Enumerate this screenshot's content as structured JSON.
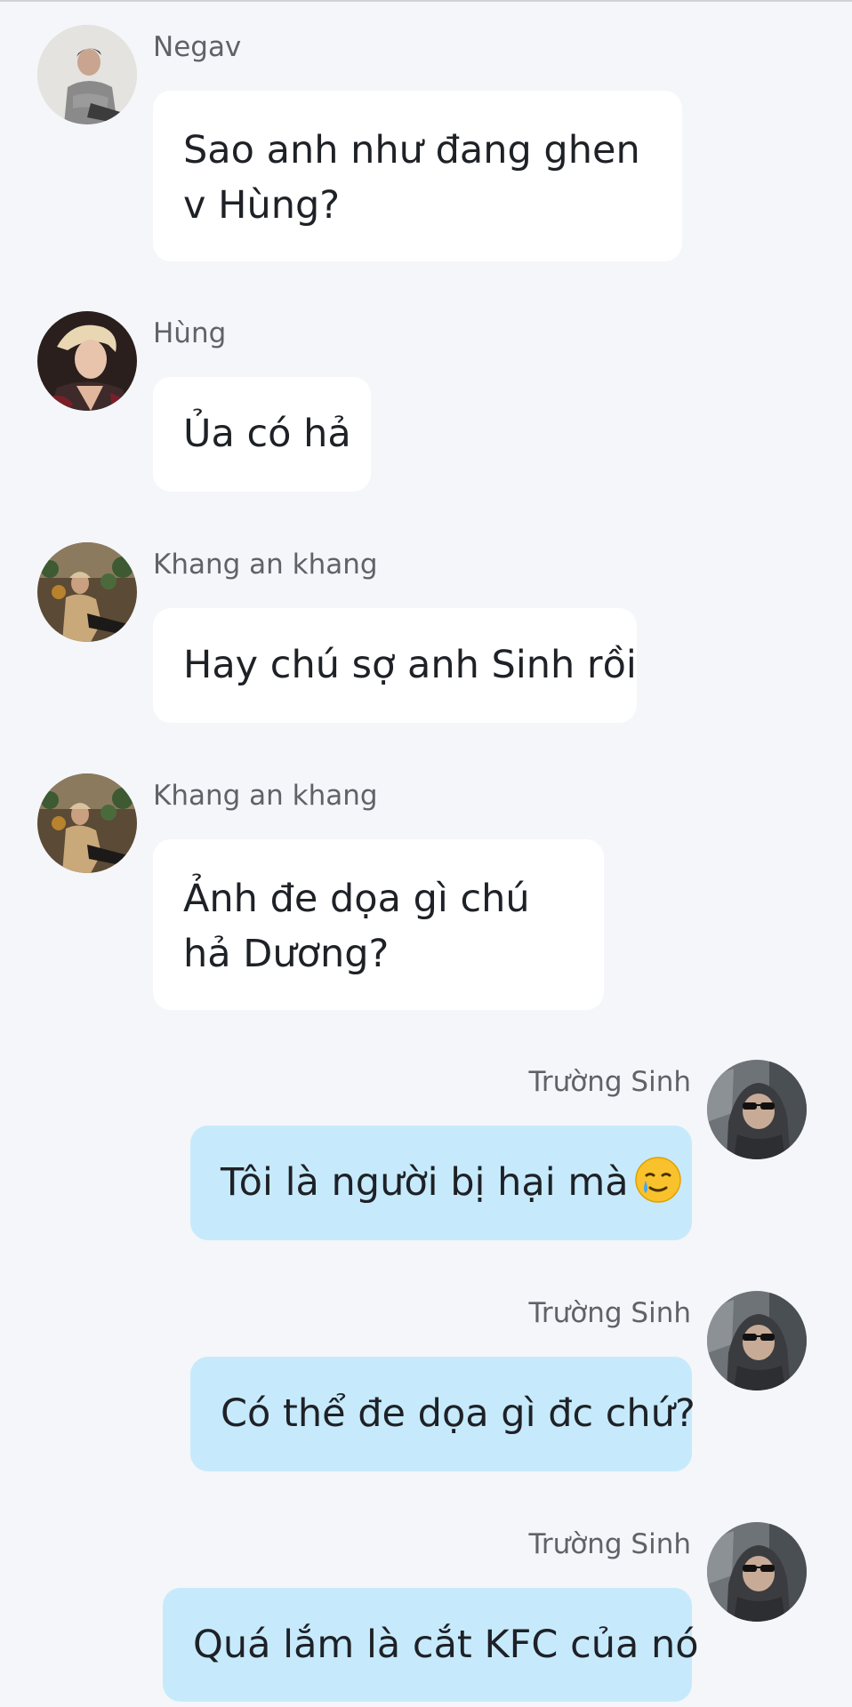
{
  "messages": [
    {
      "sender": "Negav",
      "text_lines": [
        "Sao anh như đang ghen",
        "v Hùng?"
      ],
      "direction": "incoming",
      "avatar_icon": "avatar-negav"
    },
    {
      "sender": "Hùng",
      "text_lines": [
        "Ủa có hả"
      ],
      "direction": "incoming",
      "avatar_icon": "avatar-hung"
    },
    {
      "sender": "Khang an khang",
      "text_lines": [
        "Hay chú sợ anh Sinh rồi"
      ],
      "direction": "incoming",
      "avatar_icon": "avatar-khang"
    },
    {
      "sender": "Khang an khang",
      "text_lines": [
        "Ảnh đe dọa gì chú",
        "hả Dương?"
      ],
      "direction": "incoming",
      "avatar_icon": "avatar-khang"
    },
    {
      "sender": "Trường Sinh",
      "text_lines": [
        "Tôi là người bị hại mà"
      ],
      "direction": "outgoing",
      "avatar_icon": "avatar-truong-sinh",
      "emoji": "smiling-face-with-tear-icon"
    },
    {
      "sender": "Trường Sinh",
      "text_lines": [
        "Có thể đe dọa gì đc chứ?"
      ],
      "direction": "outgoing",
      "avatar_icon": "avatar-truong-sinh"
    },
    {
      "sender": "Trường Sinh",
      "text_lines": [
        "Quá lắm là cắt KFC của nó"
      ],
      "direction": "outgoing",
      "avatar_icon": "avatar-truong-sinh"
    }
  ],
  "colors": {
    "background": "#f4f6f9",
    "incoming_bubble": "#ffffff",
    "outgoing_bubble": "#c6eafc",
    "sender_name": "#5f6368",
    "message_text": "#1e2126"
  }
}
